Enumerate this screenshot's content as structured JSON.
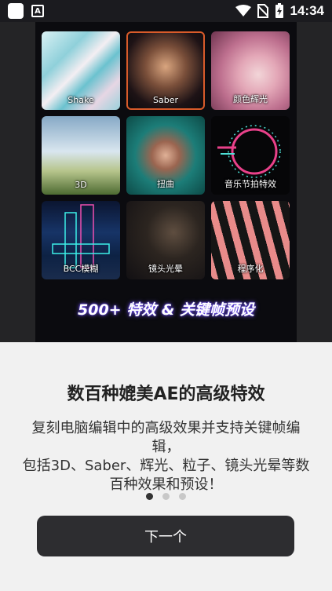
{
  "status_bar": {
    "time": "14:34",
    "a_icon": "A",
    "icons": [
      "wifi-icon",
      "no-sim-icon",
      "battery-charging-icon"
    ]
  },
  "hero": {
    "tiles": [
      {
        "label": "Shake"
      },
      {
        "label": "Saber"
      },
      {
        "label": "颜色辉光"
      },
      {
        "label": "3D"
      },
      {
        "label": "扭曲"
      },
      {
        "label": "音乐节拍特效"
      },
      {
        "label": "BCC模糊"
      },
      {
        "label": "镜头光晕"
      },
      {
        "label": "程序化"
      }
    ],
    "banner": "500+ 特效 & 关键帧预设"
  },
  "content": {
    "title": "数百种媲美AE的高级特效",
    "description_lines": [
      "复刻电脑编辑中的高级效果并支持关键帧编",
      "辑，",
      "包括3D、Saber、辉光、粒子、镜头光晕等数",
      "百种效果和预设！"
    ]
  },
  "pager": {
    "count": 3,
    "active": 1
  },
  "next_button": {
    "label": "下一个"
  },
  "colors": {
    "status_bar": "#1b1b1f",
    "button": "#2d2d30",
    "background": "#f1f1f1"
  }
}
